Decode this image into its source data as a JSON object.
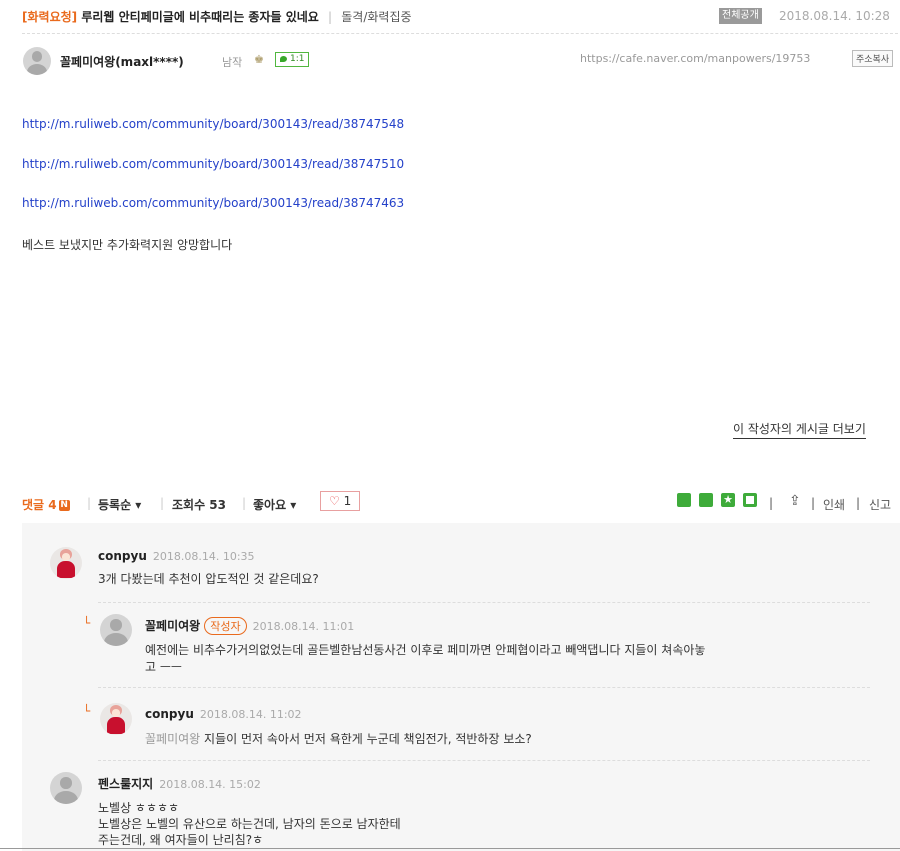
{
  "post": {
    "tag": "[화력요청]",
    "title": "루리웹 안티페미글에 비추때리는 종자들 있네요",
    "board": "돌격/화력집중",
    "visibility": "전체공개",
    "date": "2018.08.14. 10:28",
    "author_name": "꼴페미여왕(maxl****)",
    "author_level": "남작",
    "chat_label": "1:1",
    "url": "https://cafe.naver.com/manpowers/19753",
    "copy_label": "주소복사",
    "links": [
      "http://m.ruliweb.com/community/board/300143/read/38747548",
      "http://m.ruliweb.com/community/board/300143/read/38747510",
      "http://m.ruliweb.com/community/board/300143/read/38747463"
    ],
    "body_text": "베스트 보냈지만 추가화력지원 앙망합니다",
    "more_posts_label": "이 작성자의 게시글 더보기"
  },
  "action_bar": {
    "comment_label": "댓글 4",
    "new_badge": "N",
    "sort_label": "등록순 ▾",
    "views_label": "조회수 53",
    "like_dropdown_label": "좋아요 ▾",
    "like_count": "1",
    "print_label": "인쇄",
    "report_label": "신고",
    "share_colors": [
      "#3eab3a",
      "#3eab3a",
      "#3eab3a",
      "#3eab3a"
    ]
  },
  "comments": [
    {
      "name": "conpyu",
      "date": "2018.08.14. 10:35",
      "text": "3개 다봤는데 추천이 압도적인 것 같은데요?"
    },
    {
      "name": "꼴페미여왕",
      "author_tag": "작성자",
      "date": "2018.08.14. 11:01",
      "text_line1": "예전에는 비추수가거의없었는데 골든벨한남선동사건 이후로 페미까면 안페협이라고 빼액댑니다 지들이 쳐속아놓",
      "text_line2": "고 ㅡㅡ"
    },
    {
      "name": "conpyu",
      "date": "2018.08.14. 11:02",
      "mention": "꼴페미여왕",
      "text": "지들이 먼저 속아서 먼저 욕한게 누군데 책임전가, 적반하장 보소?"
    },
    {
      "name": "펜스룰지지",
      "date": "2018.08.14. 15:02",
      "text_line1": "노벨상 ㅎㅎㅎㅎ",
      "text_line2": "노벨상은 노벨의 유산으로 하는건데, 남자의 돈으로 남자한테",
      "text_line3": "주는건데, 왜 여자들이 난리침?ㅎ"
    }
  ]
}
